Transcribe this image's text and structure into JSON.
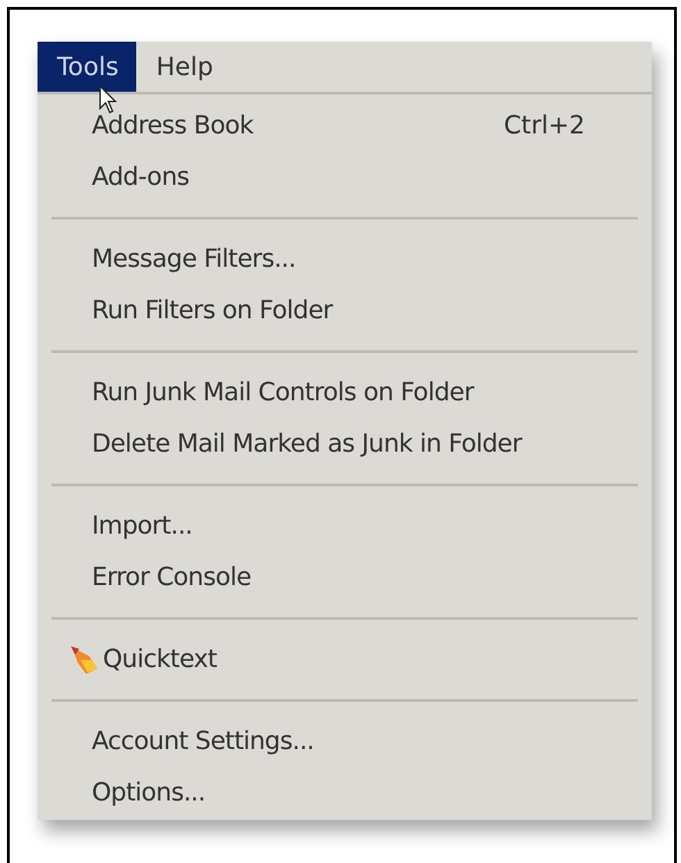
{
  "menubar": [
    {
      "label": "Tools",
      "selected": true
    },
    {
      "label": "Help",
      "selected": false
    }
  ],
  "menu": {
    "items": [
      {
        "kind": "command",
        "label": "Address Book",
        "shortcut": "Ctrl+2"
      },
      {
        "kind": "command",
        "label": "Add-ons"
      },
      {
        "kind": "separator"
      },
      {
        "kind": "command",
        "label": "Message Filters..."
      },
      {
        "kind": "command",
        "label": "Run Filters on Folder"
      },
      {
        "kind": "separator"
      },
      {
        "kind": "command",
        "label": "Run Junk Mail Controls on Folder"
      },
      {
        "kind": "command",
        "label": "Delete Mail Marked as Junk in Folder"
      },
      {
        "kind": "separator"
      },
      {
        "kind": "command",
        "label": "Import..."
      },
      {
        "kind": "command",
        "label": "Error Console"
      },
      {
        "kind": "separator"
      },
      {
        "kind": "icon-command",
        "label": "Quicktext"
      },
      {
        "kind": "separator"
      },
      {
        "kind": "command",
        "label": "Account Settings..."
      },
      {
        "kind": "command",
        "label": "Options..."
      }
    ]
  }
}
